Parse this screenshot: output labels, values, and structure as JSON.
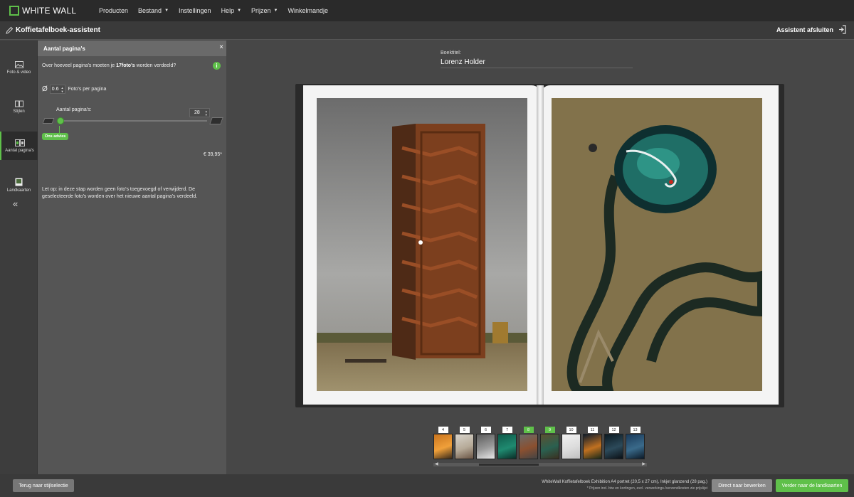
{
  "brand": {
    "logo_text": "WHITE WALL",
    "accent": "#5fc04a"
  },
  "nav": {
    "items": [
      {
        "label": "Producten",
        "has_caret": false
      },
      {
        "label": "Bestand",
        "has_caret": true
      },
      {
        "label": "Instellingen",
        "has_caret": false
      },
      {
        "label": "Help",
        "has_caret": true
      },
      {
        "label": "Prijzen",
        "has_caret": true
      },
      {
        "label": "Winkelmandje",
        "has_caret": false
      }
    ]
  },
  "header": {
    "title": "Koffietafelboek-assistent",
    "exit_label": "Assistent afsluiten"
  },
  "sidebar": {
    "items": [
      {
        "label": "Foto & video",
        "icon": "photo-icon"
      },
      {
        "label": "Stijlen",
        "icon": "book-icon"
      },
      {
        "label": "Aantal pagina's",
        "icon": "pages-icon",
        "active": true
      },
      {
        "label": "Landkaarten",
        "icon": "map-icon"
      }
    ],
    "collapse_glyph": "«"
  },
  "panel": {
    "title": "Aantal pagina's",
    "close_glyph": "×",
    "question_prefix": "Over hoeveel pagina's moeten je ",
    "question_bold": "17foto's",
    "question_suffix": " worden verdeeld?",
    "info_glyph": "i",
    "ratio_symbol": "Ø",
    "ratio_value": "0.6",
    "ratio_label": "Foto's per pagina",
    "pages_label": "Aantal pagina's:",
    "pages_value": "28",
    "slider_position": 0.02,
    "advice_badge": "Ons advies",
    "price": "€ 39,95*",
    "note": "Let op: in deze stap worden geen foto's toegevoegd of verwijderd. De geselecteerde foto's worden over het nieuwe aantal pagina's verdeeld."
  },
  "book": {
    "title_label": "Boektitel:",
    "title_value": "Lorenz Holder"
  },
  "thumbnails": [
    {
      "page": "4",
      "active": false,
      "colors": [
        "#c9741e",
        "#f0a03a",
        "#3a2a1a"
      ]
    },
    {
      "page": "5",
      "active": false,
      "colors": [
        "#d8d4cc",
        "#b6aa98",
        "#6a5444"
      ]
    },
    {
      "page": "6",
      "active": false,
      "colors": [
        "#5c5c5c",
        "#9a9a9a",
        "#e8e8e8"
      ]
    },
    {
      "page": "7",
      "active": false,
      "colors": [
        "#0f5a4a",
        "#1f8a70",
        "#0a2e28"
      ]
    },
    {
      "page": "8",
      "active": true,
      "colors": [
        "#6a6a6a",
        "#8a5030",
        "#444444"
      ]
    },
    {
      "page": "9",
      "active": true,
      "colors": [
        "#5c5030",
        "#2a6050",
        "#3a3020"
      ]
    },
    {
      "page": "10",
      "active": false,
      "colors": [
        "#f0f0f0",
        "#dcdcdc",
        "#c0c0c0"
      ]
    },
    {
      "page": "11",
      "active": false,
      "colors": [
        "#0e1c2c",
        "#c07020",
        "#1a2a1a"
      ]
    },
    {
      "page": "12",
      "active": false,
      "colors": [
        "#0c1a22",
        "#2c4a5a",
        "#0a1016"
      ]
    },
    {
      "page": "13",
      "active": false,
      "colors": [
        "#1a3a5a",
        "#3a6a8a",
        "#0c1a28"
      ]
    }
  ],
  "footer": {
    "back_label": "Terug naar stijlselectie",
    "product_desc": "WhiteWall Koffietafelboek Exhibition A4 portret (20,5 x 27 cm), Inkjet glanzend (28 pag.)",
    "price_note": "* Prijzen incl. btw en kortingen, excl. verwerkings-/verzendkosten zie prijslijst",
    "edit_label": "Direct naar bewerken",
    "next_label": "Verder naar de landkaarten"
  }
}
